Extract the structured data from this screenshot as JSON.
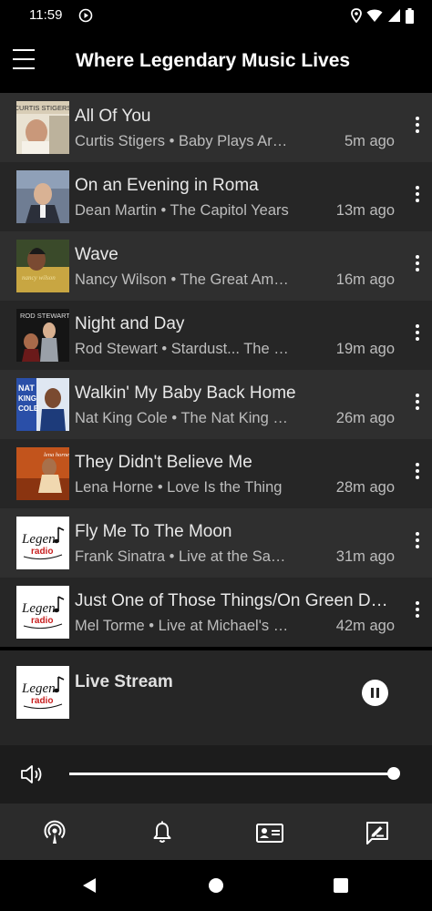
{
  "status_bar": {
    "time": "11:59"
  },
  "app_bar": {
    "title": "Where Legendary Music Lives"
  },
  "colors": {
    "background": "#000000",
    "row_dark": "#262626",
    "row_light": "#2f2f2f",
    "text_primary": "#e8e8e8",
    "text_secondary": "#bdbdbd"
  },
  "recent_tracks": [
    {
      "title": "All Of You",
      "subtitle": "Curtis Stigers • Baby Plays Around",
      "time": "5m ago",
      "art": "curtis-stigers-cover"
    },
    {
      "title": "On an Evening in Roma",
      "subtitle": "Dean Martin • The Capitol Years",
      "time": "13m ago",
      "art": "dean-martin-cover"
    },
    {
      "title": "Wave",
      "subtitle": "Nancy Wilson • The Great American Songbook",
      "time": "16m ago",
      "art": "nancy-wilson-cover"
    },
    {
      "title": "Night and Day",
      "subtitle": "Rod Stewart • Stardust... The Great American Songbook",
      "time": "19m ago",
      "art": "rod-stewart-cover"
    },
    {
      "title": "Walkin' My Baby Back Home",
      "subtitle": "Nat King Cole • The Nat King Cole Story",
      "time": "26m ago",
      "art": "nat-king-cole-cover"
    },
    {
      "title": "They Didn't Believe Me",
      "subtitle": "Lena Horne • Love Is the Thing",
      "time": "28m ago",
      "art": "lena-horne-cover"
    },
    {
      "title": "Fly Me To The Moon",
      "subtitle": "Frank Sinatra • Live at the Sands",
      "time": "31m ago",
      "art": "legends-radio-logo"
    },
    {
      "title": "Just One of Those Things/On Green Dolphin Street",
      "subtitle": "Mel Torme • Live at Michael's Pub",
      "time": "42m ago",
      "art": "legends-radio-logo"
    }
  ],
  "now_playing": {
    "title": "Live Stream",
    "art": "legends-radio-logo"
  },
  "volume": {
    "level": 1.0
  },
  "bottom_nav": [
    {
      "name": "podcast-icon"
    },
    {
      "name": "bell-icon"
    },
    {
      "name": "contact-card-icon"
    },
    {
      "name": "edit-message-icon"
    }
  ]
}
